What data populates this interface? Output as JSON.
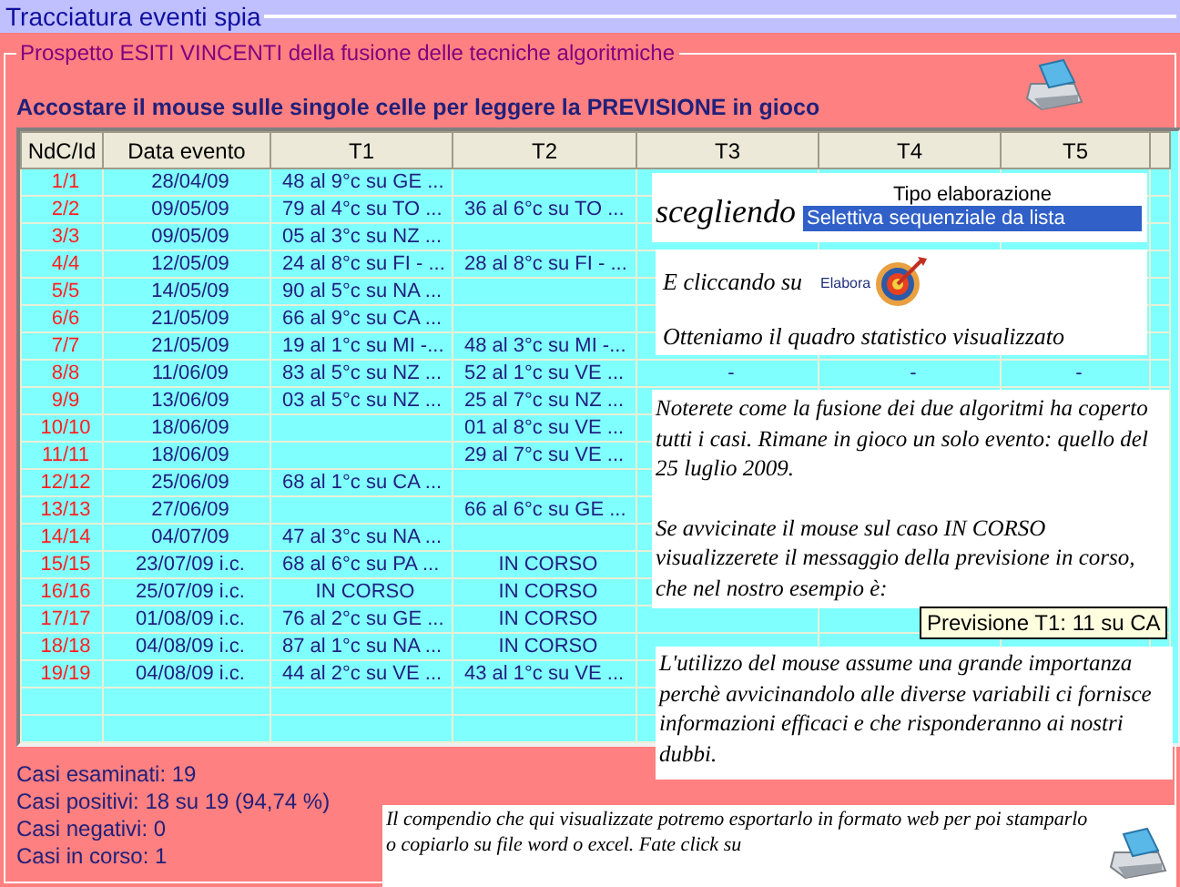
{
  "window": {
    "title": "Tracciatura eventi spia"
  },
  "group": {
    "title": "Prospetto ESITI VINCENTI della fusione delle tecniche algoritmiche"
  },
  "heading": "Accostare il mouse sulle singole celle per leggere la PREVISIONE in gioco",
  "table": {
    "columns": [
      "NdC/Id",
      "Data evento",
      "T1",
      "T2",
      "T3",
      "T4",
      "T5"
    ],
    "rows": [
      {
        "id": "1/1",
        "date": "28/04/09",
        "t1": "48 al 9°c su GE ..."
      },
      {
        "id": "2/2",
        "date": "09/05/09",
        "t1": "79 al 4°c su TO ...",
        "t2": "36 al 6°c su TO ..."
      },
      {
        "id": "3/3",
        "date": "09/05/09",
        "t1": "05 al 3°c su NZ ..."
      },
      {
        "id": "4/4",
        "date": "12/05/09",
        "t1": "24 al 8°c su FI - ...",
        "t2": "28 al 8°c su FI - ..."
      },
      {
        "id": "5/5",
        "date": "14/05/09",
        "t1": "90 al 5°c su NA ..."
      },
      {
        "id": "6/6",
        "date": "21/05/09",
        "t1": "66 al 9°c su CA ..."
      },
      {
        "id": "7/7",
        "date": "21/05/09",
        "t1": "19 al 1°c su MI -...",
        "t2": "48 al 3°c su MI -..."
      },
      {
        "id": "8/8",
        "date": "11/06/09",
        "t1": "83 al 5°c su NZ ...",
        "t2": "52 al 1°c su VE ...",
        "t3": "-",
        "t4": "-",
        "t5": "-"
      },
      {
        "id": "9/9",
        "date": "13/06/09",
        "t1": "03 al 5°c su NZ ...",
        "t2": "25 al 7°c su NZ ..."
      },
      {
        "id": "10/10",
        "date": "18/06/09",
        "t2": "01 al 8°c su VE ..."
      },
      {
        "id": "11/11",
        "date": "18/06/09",
        "t2": "29 al 7°c su VE ..."
      },
      {
        "id": "12/12",
        "date": "25/06/09",
        "t1": "68 al 1°c su CA ..."
      },
      {
        "id": "13/13",
        "date": "27/06/09",
        "t2": "66 al 6°c su GE ..."
      },
      {
        "id": "14/14",
        "date": "04/07/09",
        "t1": "47 al 3°c su NA ..."
      },
      {
        "id": "15/15",
        "date": "23/07/09 i.c.",
        "t1": "68 al 6°c su PA ...",
        "t2": "IN CORSO"
      },
      {
        "id": "16/16",
        "date": "25/07/09 i.c.",
        "t1": "IN CORSO",
        "t2": "IN CORSO"
      },
      {
        "id": "17/17",
        "date": "01/08/09 i.c.",
        "t1": "76 al 2°c su GE ...",
        "t2": "IN CORSO"
      },
      {
        "id": "18/18",
        "date": "04/08/09 i.c.",
        "t1": "87 al 1°c su NA ...",
        "t2": "IN CORSO"
      },
      {
        "id": "19/19",
        "date": "04/08/09 i.c.",
        "t1": "44 al 2°c su VE ...",
        "t2": "43 al 1°c su VE ..."
      }
    ]
  },
  "stats": [
    "Casi esaminati: 19",
    "Casi positivi: 18 su 19 (94,74 %)",
    "Casi negativi: 0",
    "Casi in corso: 1"
  ],
  "notes": {
    "choice": {
      "lead": "scegliendo",
      "label": "Tipo elaborazione",
      "value": "Selettiva sequenziale da lista"
    },
    "elabora": {
      "text": "E cliccando su",
      "button": "Elabora",
      "result": "Otteniamo il quadro statistico visualizzato"
    },
    "fusion": [
      "Noterete come la fusione dei due algoritmi ha coperto tutti i casi. Rimane in gioco un solo evento: quello del 25 luglio 2009.",
      "Se avvicinate il mouse sul caso IN CORSO visualizzerete il messaggio della previsione in corso, che nel nostro esempio è:"
    ],
    "tooltip": "Previsione T1: 11 su CA",
    "mouse": "L'utilizzo del mouse assume una grande importanza perchè avvicinandolo alle diverse variabili ci fornisce informazioni efficaci e che risponderanno ai nostri dubbi.",
    "export": "Il compendio che qui visualizzate potremo esportarlo in formato web per poi stamparlo o copiarlo su file word o excel. Fate click su"
  }
}
